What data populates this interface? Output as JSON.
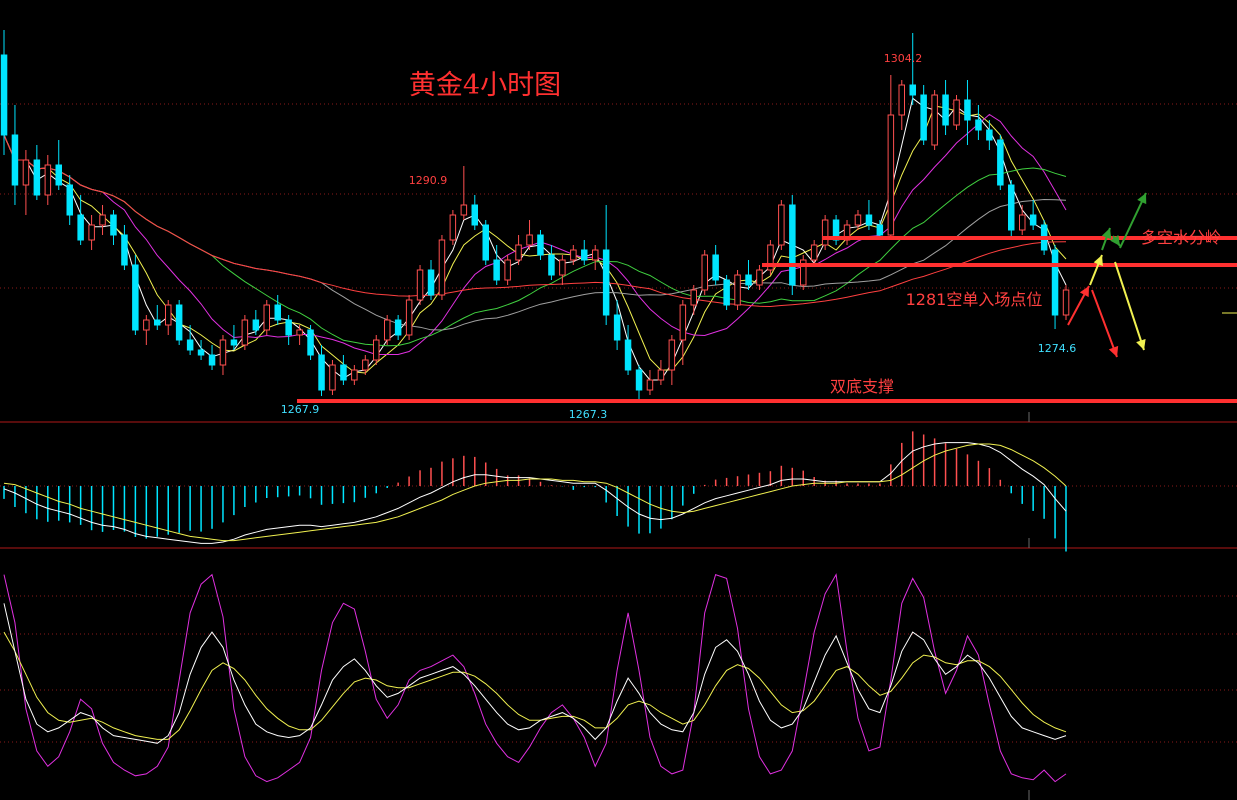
{
  "chart_data": {
    "type": "candlestick",
    "title": "黄金4小时图",
    "colors": {
      "background": "#000000",
      "up": "#ff5050",
      "down": "#00e5ff",
      "level_line": "#ff3030",
      "grid": "#8a1a1a",
      "title": "#ff3030",
      "ma_white": "#ffffff",
      "ma_yellow": "#f0f050",
      "ma_magenta": "#e030e0",
      "ma_green": "#40d040",
      "ma_grey": "#a0a0a0",
      "ma_red": "#ff4040"
    },
    "price_labels": [
      {
        "id": "high",
        "text": "1304.2"
      },
      {
        "id": "mid-high",
        "text": "1290.9"
      },
      {
        "id": "low-1",
        "text": "1267.9"
      },
      {
        "id": "low-2",
        "text": "1267.3"
      },
      {
        "id": "recent-low",
        "text": "1274.6"
      }
    ],
    "levels": [
      {
        "id": "bull-bear-line",
        "price": 1283.7,
        "label": "多空水分岭"
      },
      {
        "id": "short-entry",
        "price": 1281.0,
        "label": "1281空单入场点位"
      },
      {
        "id": "double-bottom",
        "price": 1267.4,
        "label": "双底支撑"
      }
    ],
    "main_ylim": [
      1266.5,
      1306.5
    ],
    "candles": [
      [
        1302.0,
        1304.5,
        1292.0,
        1294.0
      ],
      [
        1294.0,
        1297.0,
        1287.0,
        1289.0
      ],
      [
        1289.0,
        1292.5,
        1286.0,
        1291.5
      ],
      [
        1291.5,
        1293.0,
        1287.5,
        1288.0
      ],
      [
        1288.0,
        1292.0,
        1287.0,
        1291.0
      ],
      [
        1291.0,
        1293.5,
        1288.5,
        1289.0
      ],
      [
        1289.0,
        1290.0,
        1285.0,
        1286.0
      ],
      [
        1286.0,
        1288.0,
        1283.0,
        1283.5
      ],
      [
        1283.5,
        1286.0,
        1282.5,
        1285.0
      ],
      [
        1285.0,
        1287.0,
        1284.0,
        1286.0
      ],
      [
        1286.0,
        1286.5,
        1283.0,
        1284.0
      ],
      [
        1284.0,
        1285.0,
        1280.5,
        1281.0
      ],
      [
        1281.0,
        1282.0,
        1274.0,
        1274.5
      ],
      [
        1274.5,
        1276.0,
        1273.0,
        1275.5
      ],
      [
        1275.5,
        1277.0,
        1274.5,
        1275.0
      ],
      [
        1275.0,
        1277.5,
        1274.0,
        1277.0
      ],
      [
        1277.0,
        1277.5,
        1273.0,
        1273.5
      ],
      [
        1273.5,
        1275.0,
        1272.0,
        1272.5
      ],
      [
        1272.5,
        1273.5,
        1271.5,
        1272.0
      ],
      [
        1272.0,
        1273.0,
        1270.5,
        1271.0
      ],
      [
        1271.0,
        1274.0,
        1270.0,
        1273.5
      ],
      [
        1273.5,
        1275.0,
        1272.5,
        1273.0
      ],
      [
        1273.0,
        1276.0,
        1272.5,
        1275.5
      ],
      [
        1275.5,
        1276.5,
        1274.0,
        1274.5
      ],
      [
        1274.5,
        1277.5,
        1274.0,
        1277.0
      ],
      [
        1277.0,
        1278.0,
        1275.0,
        1275.5
      ],
      [
        1275.5,
        1276.0,
        1273.0,
        1274.0
      ],
      [
        1274.0,
        1275.0,
        1273.0,
        1274.5
      ],
      [
        1274.5,
        1275.0,
        1271.5,
        1272.0
      ],
      [
        1272.0,
        1273.0,
        1267.9,
        1268.5
      ],
      [
        1268.5,
        1271.5,
        1268.0,
        1271.0
      ],
      [
        1271.0,
        1272.0,
        1269.0,
        1269.5
      ],
      [
        1269.5,
        1271.0,
        1269.0,
        1270.5
      ],
      [
        1270.5,
        1272.0,
        1270.0,
        1271.5
      ],
      [
        1271.5,
        1274.0,
        1271.0,
        1273.5
      ],
      [
        1273.5,
        1276.0,
        1273.0,
        1275.5
      ],
      [
        1275.5,
        1276.0,
        1273.5,
        1274.0
      ],
      [
        1274.0,
        1278.0,
        1273.5,
        1277.5
      ],
      [
        1277.5,
        1281.0,
        1277.0,
        1280.5
      ],
      [
        1280.5,
        1281.5,
        1277.5,
        1278.0
      ],
      [
        1278.0,
        1284.0,
        1277.5,
        1283.5
      ],
      [
        1283.5,
        1286.5,
        1283.0,
        1286.0
      ],
      [
        1286.0,
        1290.9,
        1285.5,
        1287.0
      ],
      [
        1287.0,
        1288.0,
        1284.5,
        1285.0
      ],
      [
        1285.0,
        1285.5,
        1281.0,
        1281.5
      ],
      [
        1281.5,
        1283.0,
        1279.0,
        1279.5
      ],
      [
        1279.5,
        1282.0,
        1279.0,
        1281.5
      ],
      [
        1281.5,
        1284.0,
        1281.0,
        1283.0
      ],
      [
        1283.0,
        1285.5,
        1282.5,
        1284.0
      ],
      [
        1284.0,
        1284.5,
        1281.5,
        1282.0
      ],
      [
        1282.0,
        1283.0,
        1279.5,
        1280.0
      ],
      [
        1280.0,
        1282.0,
        1279.0,
        1281.5
      ],
      [
        1281.5,
        1283.0,
        1281.0,
        1282.5
      ],
      [
        1282.5,
        1283.5,
        1281.0,
        1281.5
      ],
      [
        1281.5,
        1283.0,
        1280.5,
        1282.5
      ],
      [
        1282.5,
        1287.0,
        1275.0,
        1276.0
      ],
      [
        1276.0,
        1277.5,
        1272.5,
        1273.5
      ],
      [
        1273.5,
        1275.0,
        1270.0,
        1270.5
      ],
      [
        1270.5,
        1271.0,
        1267.3,
        1268.5
      ],
      [
        1268.5,
        1270.5,
        1268.0,
        1269.5
      ],
      [
        1269.5,
        1271.5,
        1269.0,
        1270.5
      ],
      [
        1270.5,
        1274.0,
        1269.0,
        1273.5
      ],
      [
        1273.5,
        1277.5,
        1271.0,
        1277.0
      ],
      [
        1277.0,
        1279.0,
        1276.0,
        1278.5
      ],
      [
        1278.5,
        1282.5,
        1278.0,
        1282.0
      ],
      [
        1282.0,
        1283.0,
        1279.0,
        1279.5
      ],
      [
        1279.5,
        1280.0,
        1276.5,
        1277.0
      ],
      [
        1277.0,
        1280.5,
        1276.5,
        1280.0
      ],
      [
        1280.0,
        1281.5,
        1278.5,
        1279.0
      ],
      [
        1279.0,
        1281.0,
        1278.5,
        1280.5
      ],
      [
        1280.5,
        1283.5,
        1280.0,
        1283.0
      ],
      [
        1283.0,
        1287.5,
        1282.5,
        1287.0
      ],
      [
        1287.0,
        1288.0,
        1278.0,
        1279.0
      ],
      [
        1279.0,
        1282.0,
        1278.5,
        1281.5
      ],
      [
        1281.5,
        1283.5,
        1281.0,
        1283.0
      ],
      [
        1283.0,
        1286.0,
        1282.5,
        1285.5
      ],
      [
        1285.5,
        1286.0,
        1283.0,
        1283.5
      ],
      [
        1283.5,
        1285.5,
        1283.0,
        1285.0
      ],
      [
        1285.0,
        1286.5,
        1284.5,
        1286.0
      ],
      [
        1286.0,
        1287.5,
        1284.5,
        1285.0
      ],
      [
        1285.0,
        1285.5,
        1283.5,
        1284.0
      ],
      [
        1284.0,
        1300.0,
        1283.5,
        1296.0
      ],
      [
        1296.0,
        1299.5,
        1294.5,
        1299.0
      ],
      [
        1299.0,
        1304.2,
        1297.0,
        1298.0
      ],
      [
        1298.0,
        1299.0,
        1293.0,
        1293.5
      ],
      [
        1293.0,
        1298.5,
        1292.5,
        1298.0
      ],
      [
        1298.0,
        1299.5,
        1294.0,
        1295.0
      ],
      [
        1295.0,
        1298.0,
        1294.5,
        1297.5
      ],
      [
        1297.5,
        1299.5,
        1293.0,
        1295.5
      ],
      [
        1295.5,
        1297.0,
        1293.5,
        1294.5
      ],
      [
        1294.5,
        1295.5,
        1292.5,
        1293.5
      ],
      [
        1293.5,
        1294.0,
        1288.5,
        1289.0
      ],
      [
        1289.0,
        1289.5,
        1283.5,
        1284.5
      ],
      [
        1284.5,
        1287.0,
        1284.0,
        1286.0
      ],
      [
        1286.0,
        1287.5,
        1284.5,
        1285.0
      ],
      [
        1285.0,
        1285.5,
        1282.0,
        1282.5
      ],
      [
        1282.5,
        1283.0,
        1274.6,
        1276.0
      ],
      [
        1276.0,
        1279.0,
        1275.5,
        1278.5
      ]
    ],
    "macd": {
      "dif": [
        -0.2,
        -0.5,
        -0.9,
        -1.3,
        -1.6,
        -1.8,
        -2.0,
        -2.3,
        -2.6,
        -2.8,
        -2.9,
        -3.1,
        -3.4,
        -3.6,
        -3.7,
        -3.8,
        -3.9,
        -4.0,
        -4.1,
        -4.1,
        -4.0,
        -3.8,
        -3.5,
        -3.3,
        -3.1,
        -3.0,
        -2.9,
        -2.8,
        -2.8,
        -2.9,
        -2.8,
        -2.7,
        -2.6,
        -2.4,
        -2.2,
        -1.9,
        -1.6,
        -1.2,
        -0.8,
        -0.5,
        -0.1,
        0.3,
        0.6,
        0.8,
        0.8,
        0.7,
        0.6,
        0.6,
        0.6,
        0.5,
        0.4,
        0.3,
        0.2,
        0.2,
        0.2,
        -0.3,
        -0.9,
        -1.5,
        -2.0,
        -2.3,
        -2.4,
        -2.3,
        -2.0,
        -1.6,
        -1.2,
        -0.9,
        -0.7,
        -0.5,
        -0.3,
        -0.1,
        0.1,
        0.4,
        0.5,
        0.5,
        0.4,
        0.3,
        0.3,
        0.3,
        0.3,
        0.3,
        0.3,
        0.9,
        1.8,
        2.5,
        2.8,
        3.0,
        3.1,
        3.1,
        3.1,
        3.0,
        2.8,
        2.4,
        1.8,
        1.2,
        0.7,
        0.1,
        -0.9,
        -1.8
      ],
      "dea": [
        0.2,
        0.1,
        -0.2,
        -0.5,
        -0.8,
        -1.1,
        -1.3,
        -1.6,
        -1.8,
        -2.0,
        -2.2,
        -2.4,
        -2.6,
        -2.8,
        -3.0,
        -3.2,
        -3.4,
        -3.6,
        -3.7,
        -3.8,
        -3.9,
        -3.9,
        -3.8,
        -3.7,
        -3.6,
        -3.5,
        -3.4,
        -3.3,
        -3.2,
        -3.1,
        -3.0,
        -2.9,
        -2.8,
        -2.7,
        -2.6,
        -2.4,
        -2.2,
        -1.9,
        -1.6,
        -1.3,
        -1.0,
        -0.6,
        -0.3,
        0.0,
        0.2,
        0.3,
        0.4,
        0.4,
        0.5,
        0.5,
        0.5,
        0.4,
        0.4,
        0.3,
        0.3,
        0.2,
        -0.1,
        -0.5,
        -0.9,
        -1.3,
        -1.6,
        -1.8,
        -1.9,
        -1.8,
        -1.6,
        -1.4,
        -1.2,
        -1.0,
        -0.8,
        -0.6,
        -0.4,
        -0.2,
        0.0,
        0.1,
        0.2,
        0.2,
        0.2,
        0.3,
        0.3,
        0.3,
        0.3,
        0.4,
        0.8,
        1.3,
        1.8,
        2.2,
        2.5,
        2.7,
        2.9,
        3.0,
        3.0,
        2.9,
        2.6,
        2.2,
        1.8,
        1.3,
        0.7,
        0.0
      ]
    },
    "kdj": {
      "k": [
        95,
        70,
        45,
        32,
        28,
        30,
        34,
        38,
        36,
        30,
        26,
        25,
        24,
        23,
        22,
        26,
        38,
        58,
        72,
        80,
        72,
        55,
        42,
        32,
        28,
        26,
        25,
        26,
        30,
        42,
        55,
        62,
        66,
        60,
        52,
        46,
        48,
        52,
        56,
        58,
        60,
        62,
        58,
        52,
        45,
        38,
        32,
        29,
        30,
        34,
        36,
        38,
        35,
        30,
        24,
        30,
        44,
        56,
        48,
        38,
        32,
        29,
        28,
        38,
        58,
        72,
        76,
        70,
        58,
        44,
        34,
        30,
        32,
        40,
        54,
        68,
        78,
        64,
        50,
        40,
        38,
        52,
        70,
        80,
        76,
        66,
        58,
        62,
        68,
        64,
        56,
        46,
        36,
        30,
        28,
        26,
        24,
        26
      ],
      "d": [
        80,
        70,
        58,
        46,
        38,
        34,
        33,
        34,
        35,
        33,
        30,
        28,
        26,
        25,
        24,
        24,
        29,
        39,
        50,
        60,
        64,
        61,
        55,
        47,
        40,
        35,
        31,
        29,
        29,
        34,
        41,
        48,
        54,
        56,
        55,
        52,
        51,
        51,
        53,
        55,
        57,
        59,
        59,
        57,
        53,
        48,
        42,
        37,
        34,
        34,
        35,
        36,
        36,
        34,
        30,
        30,
        35,
        42,
        44,
        42,
        38,
        35,
        32,
        34,
        42,
        52,
        60,
        63,
        61,
        56,
        49,
        42,
        38,
        39,
        44,
        52,
        60,
        62,
        58,
        52,
        47,
        49,
        56,
        64,
        68,
        67,
        64,
        63,
        65,
        65,
        62,
        57,
        50,
        43,
        37,
        33,
        30,
        28
      ],
      "j": [
        110,
        85,
        40,
        18,
        10,
        15,
        28,
        45,
        40,
        22,
        12,
        8,
        5,
        6,
        10,
        20,
        55,
        90,
        105,
        110,
        88,
        40,
        15,
        5,
        2,
        4,
        8,
        12,
        25,
        60,
        85,
        95,
        92,
        70,
        45,
        35,
        42,
        55,
        60,
        62,
        65,
        68,
        62,
        48,
        32,
        22,
        15,
        12,
        20,
        30,
        38,
        42,
        35,
        25,
        10,
        22,
        60,
        90,
        60,
        25,
        10,
        6,
        8,
        38,
        90,
        110,
        108,
        82,
        40,
        15,
        6,
        8,
        18,
        48,
        80,
        100,
        110,
        70,
        35,
        18,
        20,
        55,
        95,
        108,
        98,
        70,
        48,
        60,
        78,
        68,
        42,
        18,
        6,
        4,
        3,
        8,
        2,
        6
      ]
    }
  },
  "axis_marks": {
    "tick_slot": "1.5"
  }
}
